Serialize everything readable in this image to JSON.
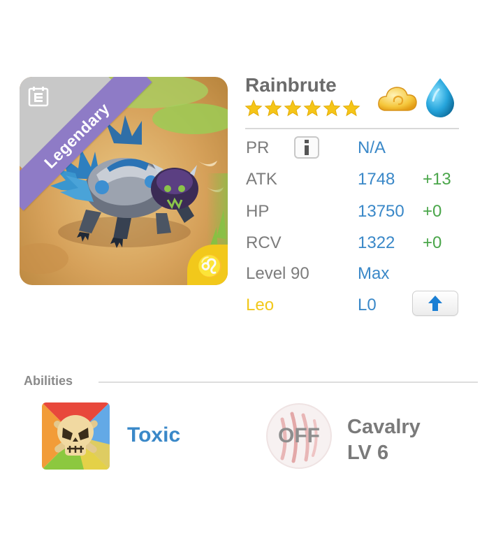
{
  "monster": {
    "name": "Rainbrute",
    "rarity": "Legendary",
    "stars": 6,
    "star_color": "#f5c518",
    "zodiac_symbol": "♌",
    "elements": [
      "cloud-element-icon",
      "water-element-icon"
    ]
  },
  "stats": {
    "pr": {
      "label": "PR",
      "value": "N/A"
    },
    "atk": {
      "label": "ATK",
      "value": "1748",
      "bonus": "+13"
    },
    "hp": {
      "label": "HP",
      "value": "13750",
      "bonus": "+0"
    },
    "rcv": {
      "label": "RCV",
      "value": "1322",
      "bonus": "+0"
    },
    "level": {
      "label": "Level 90",
      "value": "Max"
    },
    "zodiac": {
      "label": "Leo",
      "value": "L0"
    }
  },
  "abilities": {
    "title": "Abilities",
    "active": {
      "name": "Toxic"
    },
    "leader": {
      "status": "OFF",
      "name_line1": "Cavalry",
      "name_line2": "LV 6"
    }
  },
  "colors": {
    "accent_blue": "#3a88c8",
    "bonus_green": "#4aa64a",
    "rarity_purple": "#8e7bc6",
    "zodiac_yellow": "#f2c81b"
  }
}
